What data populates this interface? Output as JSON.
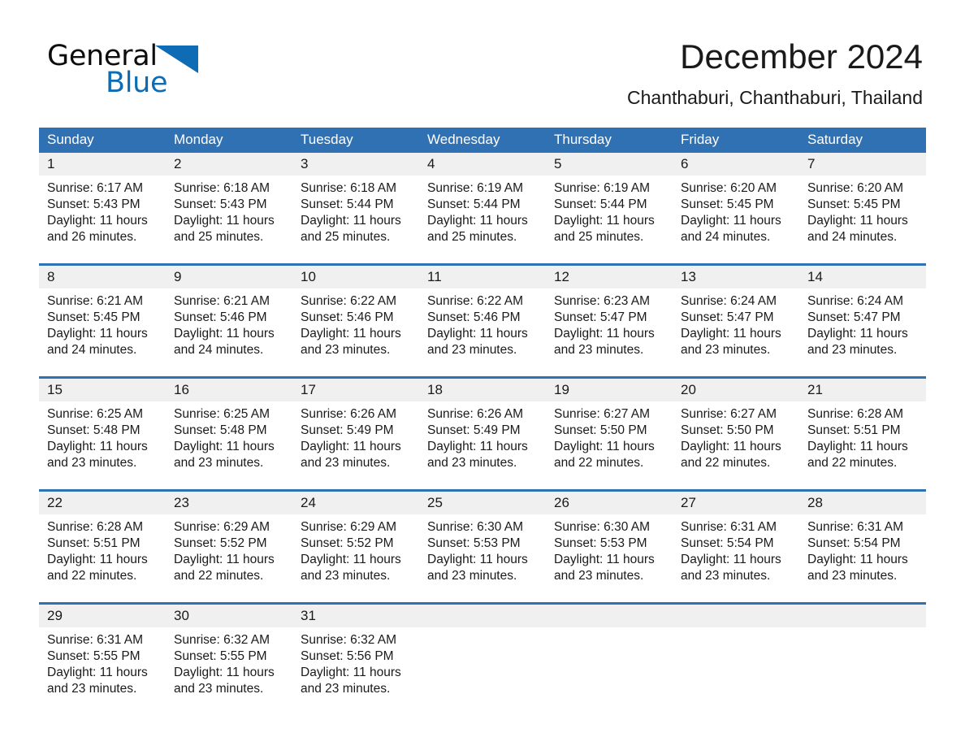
{
  "brand": {
    "word1": "General",
    "word2": "Blue",
    "triangle_color": "#0d6cb4",
    "logo_icon": "triangle-flag-icon"
  },
  "header": {
    "title": "December 2024",
    "subtitle": "Chanthaburi, Chanthaburi, Thailand"
  },
  "theme": {
    "header_blue": "#3071b4",
    "daynum_band": "#f0f0f0",
    "text": "#1a1a1a"
  },
  "calendar": {
    "weekdays": [
      "Sunday",
      "Monday",
      "Tuesday",
      "Wednesday",
      "Thursday",
      "Friday",
      "Saturday"
    ],
    "weeks": [
      {
        "daynums": [
          "1",
          "2",
          "3",
          "4",
          "5",
          "6",
          "7"
        ],
        "cells": [
          {
            "sunrise": "Sunrise: 6:17 AM",
            "sunset": "Sunset: 5:43 PM",
            "daylight1": "Daylight: 11 hours",
            "daylight2": "and 26 minutes."
          },
          {
            "sunrise": "Sunrise: 6:18 AM",
            "sunset": "Sunset: 5:43 PM",
            "daylight1": "Daylight: 11 hours",
            "daylight2": "and 25 minutes."
          },
          {
            "sunrise": "Sunrise: 6:18 AM",
            "sunset": "Sunset: 5:44 PM",
            "daylight1": "Daylight: 11 hours",
            "daylight2": "and 25 minutes."
          },
          {
            "sunrise": "Sunrise: 6:19 AM",
            "sunset": "Sunset: 5:44 PM",
            "daylight1": "Daylight: 11 hours",
            "daylight2": "and 25 minutes."
          },
          {
            "sunrise": "Sunrise: 6:19 AM",
            "sunset": "Sunset: 5:44 PM",
            "daylight1": "Daylight: 11 hours",
            "daylight2": "and 25 minutes."
          },
          {
            "sunrise": "Sunrise: 6:20 AM",
            "sunset": "Sunset: 5:45 PM",
            "daylight1": "Daylight: 11 hours",
            "daylight2": "and 24 minutes."
          },
          {
            "sunrise": "Sunrise: 6:20 AM",
            "sunset": "Sunset: 5:45 PM",
            "daylight1": "Daylight: 11 hours",
            "daylight2": "and 24 minutes."
          }
        ]
      },
      {
        "daynums": [
          "8",
          "9",
          "10",
          "11",
          "12",
          "13",
          "14"
        ],
        "cells": [
          {
            "sunrise": "Sunrise: 6:21 AM",
            "sunset": "Sunset: 5:45 PM",
            "daylight1": "Daylight: 11 hours",
            "daylight2": "and 24 minutes."
          },
          {
            "sunrise": "Sunrise: 6:21 AM",
            "sunset": "Sunset: 5:46 PM",
            "daylight1": "Daylight: 11 hours",
            "daylight2": "and 24 minutes."
          },
          {
            "sunrise": "Sunrise: 6:22 AM",
            "sunset": "Sunset: 5:46 PM",
            "daylight1": "Daylight: 11 hours",
            "daylight2": "and 23 minutes."
          },
          {
            "sunrise": "Sunrise: 6:22 AM",
            "sunset": "Sunset: 5:46 PM",
            "daylight1": "Daylight: 11 hours",
            "daylight2": "and 23 minutes."
          },
          {
            "sunrise": "Sunrise: 6:23 AM",
            "sunset": "Sunset: 5:47 PM",
            "daylight1": "Daylight: 11 hours",
            "daylight2": "and 23 minutes."
          },
          {
            "sunrise": "Sunrise: 6:24 AM",
            "sunset": "Sunset: 5:47 PM",
            "daylight1": "Daylight: 11 hours",
            "daylight2": "and 23 minutes."
          },
          {
            "sunrise": "Sunrise: 6:24 AM",
            "sunset": "Sunset: 5:47 PM",
            "daylight1": "Daylight: 11 hours",
            "daylight2": "and 23 minutes."
          }
        ]
      },
      {
        "daynums": [
          "15",
          "16",
          "17",
          "18",
          "19",
          "20",
          "21"
        ],
        "cells": [
          {
            "sunrise": "Sunrise: 6:25 AM",
            "sunset": "Sunset: 5:48 PM",
            "daylight1": "Daylight: 11 hours",
            "daylight2": "and 23 minutes."
          },
          {
            "sunrise": "Sunrise: 6:25 AM",
            "sunset": "Sunset: 5:48 PM",
            "daylight1": "Daylight: 11 hours",
            "daylight2": "and 23 minutes."
          },
          {
            "sunrise": "Sunrise: 6:26 AM",
            "sunset": "Sunset: 5:49 PM",
            "daylight1": "Daylight: 11 hours",
            "daylight2": "and 23 minutes."
          },
          {
            "sunrise": "Sunrise: 6:26 AM",
            "sunset": "Sunset: 5:49 PM",
            "daylight1": "Daylight: 11 hours",
            "daylight2": "and 23 minutes."
          },
          {
            "sunrise": "Sunrise: 6:27 AM",
            "sunset": "Sunset: 5:50 PM",
            "daylight1": "Daylight: 11 hours",
            "daylight2": "and 22 minutes."
          },
          {
            "sunrise": "Sunrise: 6:27 AM",
            "sunset": "Sunset: 5:50 PM",
            "daylight1": "Daylight: 11 hours",
            "daylight2": "and 22 minutes."
          },
          {
            "sunrise": "Sunrise: 6:28 AM",
            "sunset": "Sunset: 5:51 PM",
            "daylight1": "Daylight: 11 hours",
            "daylight2": "and 22 minutes."
          }
        ]
      },
      {
        "daynums": [
          "22",
          "23",
          "24",
          "25",
          "26",
          "27",
          "28"
        ],
        "cells": [
          {
            "sunrise": "Sunrise: 6:28 AM",
            "sunset": "Sunset: 5:51 PM",
            "daylight1": "Daylight: 11 hours",
            "daylight2": "and 22 minutes."
          },
          {
            "sunrise": "Sunrise: 6:29 AM",
            "sunset": "Sunset: 5:52 PM",
            "daylight1": "Daylight: 11 hours",
            "daylight2": "and 22 minutes."
          },
          {
            "sunrise": "Sunrise: 6:29 AM",
            "sunset": "Sunset: 5:52 PM",
            "daylight1": "Daylight: 11 hours",
            "daylight2": "and 23 minutes."
          },
          {
            "sunrise": "Sunrise: 6:30 AM",
            "sunset": "Sunset: 5:53 PM",
            "daylight1": "Daylight: 11 hours",
            "daylight2": "and 23 minutes."
          },
          {
            "sunrise": "Sunrise: 6:30 AM",
            "sunset": "Sunset: 5:53 PM",
            "daylight1": "Daylight: 11 hours",
            "daylight2": "and 23 minutes."
          },
          {
            "sunrise": "Sunrise: 6:31 AM",
            "sunset": "Sunset: 5:54 PM",
            "daylight1": "Daylight: 11 hours",
            "daylight2": "and 23 minutes."
          },
          {
            "sunrise": "Sunrise: 6:31 AM",
            "sunset": "Sunset: 5:54 PM",
            "daylight1": "Daylight: 11 hours",
            "daylight2": "and 23 minutes."
          }
        ]
      },
      {
        "daynums": [
          "29",
          "30",
          "31",
          "",
          "",
          "",
          ""
        ],
        "cells": [
          {
            "sunrise": "Sunrise: 6:31 AM",
            "sunset": "Sunset: 5:55 PM",
            "daylight1": "Daylight: 11 hours",
            "daylight2": "and 23 minutes."
          },
          {
            "sunrise": "Sunrise: 6:32 AM",
            "sunset": "Sunset: 5:55 PM",
            "daylight1": "Daylight: 11 hours",
            "daylight2": "and 23 minutes."
          },
          {
            "sunrise": "Sunrise: 6:32 AM",
            "sunset": "Sunset: 5:56 PM",
            "daylight1": "Daylight: 11 hours",
            "daylight2": "and 23 minutes."
          },
          {
            "sunrise": "",
            "sunset": "",
            "daylight1": "",
            "daylight2": ""
          },
          {
            "sunrise": "",
            "sunset": "",
            "daylight1": "",
            "daylight2": ""
          },
          {
            "sunrise": "",
            "sunset": "",
            "daylight1": "",
            "daylight2": ""
          },
          {
            "sunrise": "",
            "sunset": "",
            "daylight1": "",
            "daylight2": ""
          }
        ]
      }
    ]
  }
}
